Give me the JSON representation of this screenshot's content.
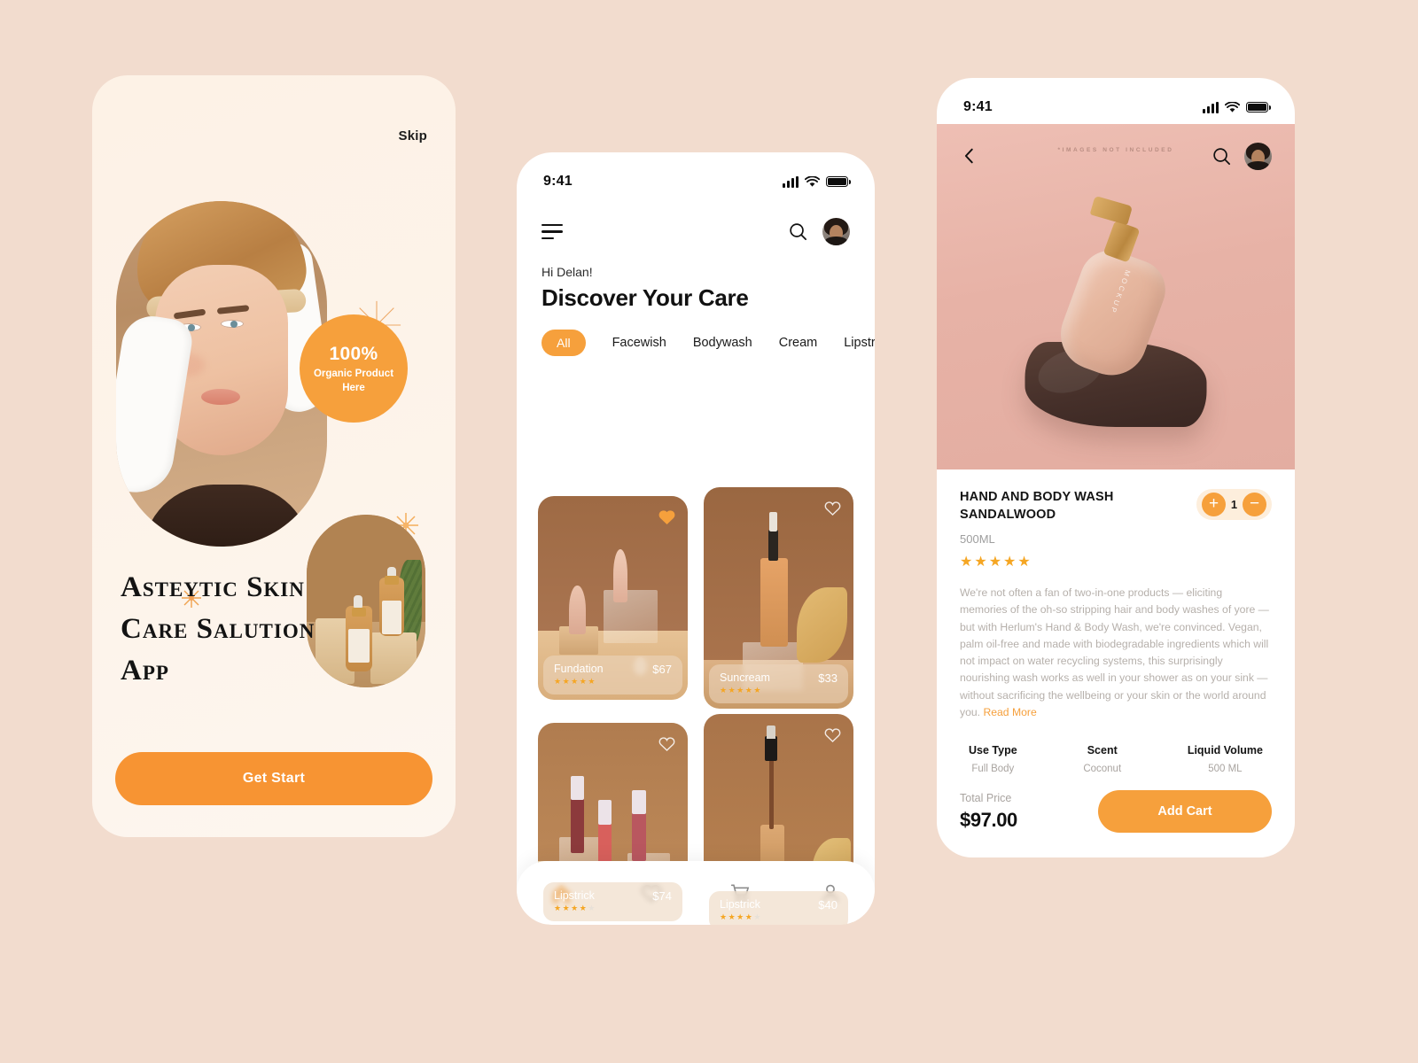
{
  "theme": {
    "page_background": "#f2dcce",
    "accent": "#f6a03c",
    "card_cream": "#fdf3e9",
    "star_color": "#f5a623"
  },
  "screen1": {
    "skip_label": "Skip",
    "badge": {
      "percent": "100%",
      "line1": "Organic Product",
      "line2": "Here"
    },
    "title": "Asteytic Skin Care Salution App",
    "cta_label": "Get Start"
  },
  "screen2": {
    "statusbar": {
      "time": "9:41"
    },
    "greeting": "Hi Delan!",
    "heading": "Discover Your Care",
    "tabs": [
      {
        "label": "All",
        "active": true
      },
      {
        "label": "Facewish",
        "active": false
      },
      {
        "label": "Bodywash",
        "active": false
      },
      {
        "label": "Cream",
        "active": false
      },
      {
        "label": "Lipstrick",
        "active": false
      }
    ],
    "products": [
      {
        "name": "Fundation",
        "price": "$67",
        "rating": 5,
        "favorite": true
      },
      {
        "name": "Suncream",
        "price": "$33",
        "rating": 5,
        "favorite": false
      },
      {
        "name": "Lipstrick",
        "price": "$74",
        "rating": 4,
        "favorite": false
      },
      {
        "name": "Lipstrick",
        "price": "$40",
        "rating": 4,
        "favorite": false
      }
    ],
    "bottom_nav": [
      {
        "name": "home",
        "active": true
      },
      {
        "name": "wishlist",
        "active": false
      },
      {
        "name": "cart",
        "active": false
      },
      {
        "name": "profile",
        "active": false
      }
    ]
  },
  "screen3": {
    "statusbar": {
      "time": "9:41"
    },
    "watermark": "*IMAGES NOT INCLUDED",
    "bottle_label": "MOCKUP",
    "title": "HAND AND BODY WASH SANDALWOOD",
    "volume": "500ML",
    "rating": 5,
    "quantity": "1",
    "description": "We're not often a fan of two-in-one products — eliciting memories of the oh-so stripping hair and body washes of yore — but with Herlum's Hand & Body Wash, we're convinced. Vegan, palm oil-free and made with biodegradable ingredients which will not impact on water recycling systems, this surprisingly nourishing wash works as well in your shower as on your sink — without sacrificing the wellbeing or your skin or the world around you. ",
    "read_more_label": "Read More",
    "specs": [
      {
        "label": "Use Type",
        "value": "Full Body"
      },
      {
        "label": "Scent",
        "value": "Coconut"
      },
      {
        "label": "Liquid Volume",
        "value": "500 ML"
      }
    ],
    "total_label": "Total Price",
    "total_price": "$97.00",
    "add_cart_label": "Add Cart"
  }
}
